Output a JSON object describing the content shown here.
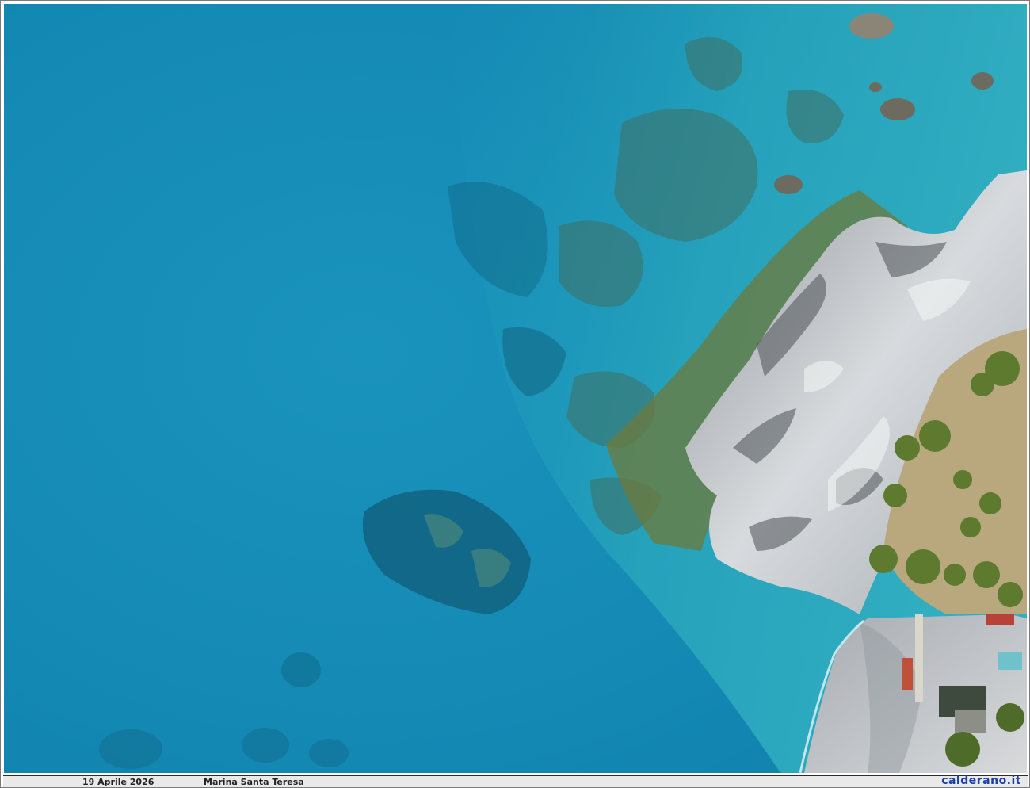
{
  "photo": {
    "subject": "aerial-coastline",
    "colors": {
      "deep_sea": "#1188b0",
      "shallow_sea": "#26a9c4",
      "rock": "#c8cdd2",
      "algae": "#6f7a3a",
      "beach": "#c9ccd0",
      "vegetation": "#5d7a2e"
    }
  },
  "caption": {
    "date": "19 Aprile 2026",
    "place": "Marina Santa Teresa",
    "site": "calderano.it",
    "site_color": "#1c3fa8"
  }
}
